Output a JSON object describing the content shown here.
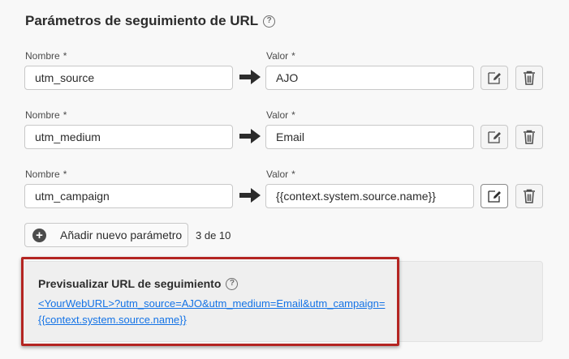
{
  "title": "Parámetros de seguimiento de URL",
  "labels": {
    "name": "Nombre",
    "value": "Valor",
    "required_mark": "*"
  },
  "params": [
    {
      "name": "utm_source",
      "value": "AJO"
    },
    {
      "name": "utm_medium",
      "value": "Email"
    },
    {
      "name": "utm_campaign",
      "value": "{{context.system.source.name}}"
    }
  ],
  "add_button": "Añadir nuevo parámetro",
  "count": "3 de 10",
  "preview": {
    "title": "Previsualizar URL de seguimiento",
    "url_line1": "<YourWebURL>?utm_source=AJO&utm_medium=Email&utm_campaign=",
    "url_line2": "{{context.system.source.name}}"
  },
  "icons": {
    "help": "help-circle-icon",
    "arrow": "arrow-right-icon",
    "edit": "edit-icon",
    "delete": "trash-icon",
    "add": "add-circle-icon"
  },
  "colors": {
    "link": "#1473e6",
    "highlight": "#b42522"
  }
}
